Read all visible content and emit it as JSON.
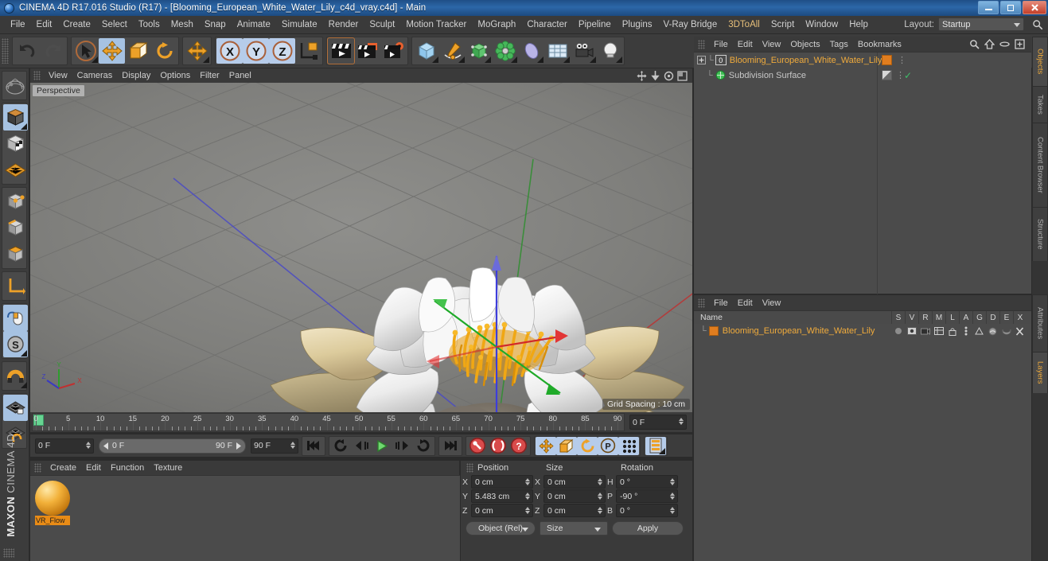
{
  "window": {
    "title": "CINEMA 4D R17.016 Studio (R17) - [Blooming_European_White_Water_Lily_c4d_vray.c4d] - Main",
    "app_icon": "c4d-logo-icon",
    "buttons": {
      "minimize": "minimize-icon",
      "restore": "restore-icon",
      "close": "close-icon"
    }
  },
  "menubar": {
    "items": [
      "File",
      "Edit",
      "Create",
      "Select",
      "Tools",
      "Mesh",
      "Snap",
      "Animate",
      "Simulate",
      "Render",
      "Sculpt",
      "Motion Tracker",
      "MoGraph",
      "Character",
      "Pipeline",
      "Plugins",
      "V-Ray Bridge",
      "3DToAll",
      "Script",
      "Window",
      "Help"
    ],
    "layout_label": "Layout:",
    "layout_value": "Startup",
    "search_icon": "search-icon"
  },
  "toolbar": {
    "groups": [
      {
        "name": "history",
        "buttons": [
          {
            "icon": "undo-icon",
            "state": "normal"
          },
          {
            "icon": "redo-icon",
            "state": "disabled"
          }
        ]
      },
      {
        "name": "transform",
        "buttons": [
          {
            "icon": "select-arrow-icon",
            "state": "normal"
          },
          {
            "icon": "move-icon",
            "state": "active"
          },
          {
            "icon": "scale-icon",
            "state": "normal"
          },
          {
            "icon": "rotate-icon",
            "state": "normal"
          }
        ]
      },
      {
        "name": "cursor",
        "buttons": [
          {
            "icon": "move-cursor-icon",
            "state": "normal"
          }
        ]
      },
      {
        "name": "axis-lock",
        "buttons": [
          {
            "icon": "x-axis-icon",
            "state": "active",
            "label": "X"
          },
          {
            "icon": "y-axis-icon",
            "state": "active",
            "label": "Y"
          },
          {
            "icon": "z-axis-icon",
            "state": "active",
            "label": "Z"
          },
          {
            "icon": "world-axis-icon",
            "state": "normal"
          }
        ]
      },
      {
        "name": "render",
        "buttons": [
          {
            "icon": "render-view-icon",
            "state": "normal"
          },
          {
            "icon": "render-to-picture-viewer-icon",
            "state": "normal"
          },
          {
            "icon": "render-settings-icon",
            "state": "normal"
          }
        ]
      },
      {
        "name": "create",
        "buttons": [
          {
            "icon": "cube-primitive-icon",
            "state": "normal"
          },
          {
            "icon": "spline-pen-icon",
            "state": "normal"
          },
          {
            "icon": "generator-nurbs-icon",
            "state": "normal"
          },
          {
            "icon": "deformer-icon",
            "state": "normal"
          },
          {
            "icon": "environment-icon",
            "state": "normal"
          },
          {
            "icon": "floor-scene-icon",
            "state": "normal"
          },
          {
            "icon": "camera-icon",
            "state": "normal"
          },
          {
            "icon": "light-icon",
            "state": "normal"
          }
        ]
      }
    ]
  },
  "lefttoolbar": {
    "groups": [
      {
        "buttons": [
          {
            "icon": "magnet-live-selection-icon",
            "state": "normal"
          }
        ]
      },
      {
        "buttons": [
          {
            "icon": "model-mode-icon",
            "state": "active"
          },
          {
            "icon": "texture-mode-icon",
            "state": "normal"
          },
          {
            "icon": "polygon-grid-icon",
            "state": "normal"
          }
        ]
      },
      {
        "buttons": [
          {
            "icon": "points-mode-icon",
            "state": "normal"
          },
          {
            "icon": "edges-mode-icon",
            "state": "normal"
          },
          {
            "icon": "polygons-mode-icon",
            "state": "normal"
          }
        ]
      },
      {
        "buttons": [
          {
            "icon": "axis-mode-icon",
            "state": "normal"
          }
        ]
      },
      {
        "buttons": [
          {
            "icon": "enable-axis-mouse-icon",
            "state": "active"
          },
          {
            "icon": "soft-selection-icon",
            "state": "active"
          }
        ]
      },
      {
        "buttons": [
          {
            "icon": "snap-magnet-icon",
            "state": "normal"
          }
        ]
      },
      {
        "buttons": [
          {
            "icon": "workplane-lock-icon",
            "state": "active"
          },
          {
            "icon": "workplane-rotate-icon",
            "state": "normal"
          }
        ]
      }
    ],
    "brand_line1": "MAXON",
    "brand_line2": "CINEMA 4D"
  },
  "viewport": {
    "menus": [
      "View",
      "Cameras",
      "Display",
      "Options",
      "Filter",
      "Panel"
    ],
    "corner_icons": [
      "pan-view-icon",
      "dolly-view-icon",
      "rotate-view-icon",
      "maximize-view-icon"
    ],
    "label": "Perspective",
    "grid_spacing": "Grid Spacing : 10 cm",
    "axis_indicator": {
      "x": "X",
      "y": "Y",
      "z": "Z"
    },
    "scene_object": "Blooming European White Water Lily",
    "gizmo": "move-gizmo-xyz"
  },
  "timeline": {
    "ruler_labels": [
      "0",
      "5",
      "10",
      "15",
      "20",
      "25",
      "30",
      "35",
      "40",
      "45",
      "50",
      "55",
      "60",
      "65",
      "70",
      "75",
      "80",
      "85",
      "90"
    ],
    "ruler_min": 0,
    "ruler_max": 90,
    "current_frame_marker": "0",
    "right_field": "0 F",
    "current_frame_field": "0 F",
    "range_start": "0 F",
    "range_end": "90 F",
    "end_frame_field": "90 F"
  },
  "transport": {
    "buttons": [
      {
        "icon": "go-to-start-icon"
      },
      {
        "icon": "play-backwards-loop-icon"
      },
      {
        "icon": "step-back-icon"
      },
      {
        "icon": "play-forward-icon"
      },
      {
        "icon": "step-forward-icon"
      },
      {
        "icon": "loop-playback-icon"
      },
      {
        "icon": "go-to-end-icon"
      },
      {
        "icon": "record-keyframe-icon"
      },
      {
        "icon": "autokeying-icon"
      },
      {
        "icon": "keyframe-selection-icon"
      },
      {
        "icon": "position-key-icon",
        "state": "active"
      },
      {
        "icon": "scale-key-icon",
        "state": "active"
      },
      {
        "icon": "rotation-key-icon",
        "state": "active"
      },
      {
        "icon": "pla-key-icon",
        "state": "active"
      },
      {
        "icon": "parameter-key-icon",
        "state": "active"
      },
      {
        "icon": "timeline-panel-icon",
        "state": "active"
      }
    ]
  },
  "material_manager": {
    "menus": [
      "Create",
      "Edit",
      "Function",
      "Texture"
    ],
    "materials": [
      {
        "name": "VR_Flow",
        "preview": "orange-sphere-preview",
        "selected": true
      }
    ]
  },
  "coordinates": {
    "columns": [
      "Position",
      "Size",
      "Rotation"
    ],
    "rows": [
      {
        "pos_label": "X",
        "pos_value": "0 cm",
        "size_label": "X",
        "size_value": "0 cm",
        "rot_label": "H",
        "rot_value": "0 °"
      },
      {
        "pos_label": "Y",
        "pos_value": "5.483 cm",
        "size_label": "Y",
        "size_value": "0 cm",
        "rot_label": "P",
        "rot_value": "-90 °"
      },
      {
        "pos_label": "Z",
        "pos_value": "0 cm",
        "size_label": "Z",
        "size_value": "0 cm",
        "rot_label": "B",
        "rot_value": "0 °"
      }
    ],
    "mode_select": "Object (Rel)",
    "size_select": "Size",
    "apply_button": "Apply"
  },
  "object_manager": {
    "menus": [
      "File",
      "Edit",
      "View",
      "Objects",
      "Tags",
      "Bookmarks"
    ],
    "header_icons": [
      "search-icon",
      "home-icon",
      "ellipse-icon",
      "expand-icon"
    ],
    "rows": [
      {
        "name": "Blooming_European_White_Water_Lily",
        "selected": true,
        "level": 0,
        "badge": "0",
        "tag_color": "#e07d1f",
        "expander": "+"
      },
      {
        "name": "Subdivision Surface",
        "selected": false,
        "level": 1,
        "icon": "subdivision-surface-icon",
        "check": true
      }
    ]
  },
  "attribute_manager": {
    "menus": [
      "File",
      "Edit",
      "View"
    ],
    "name_column": "Name",
    "columns": [
      "S",
      "V",
      "R",
      "M",
      "L",
      "A",
      "G",
      "D",
      "E",
      "X"
    ],
    "rows": [
      {
        "name": "Blooming_European_White_Water_Lily",
        "swatch": "#e07d1f",
        "selected": true
      }
    ]
  },
  "edge_tabs": {
    "top": [
      {
        "label": "Objects",
        "active": true
      },
      {
        "label": "Takes",
        "active": false
      },
      {
        "label": "Content Browser",
        "active": false
      },
      {
        "label": "Structure",
        "active": false
      }
    ],
    "bottom": [
      {
        "label": "Attributes",
        "active": false
      },
      {
        "label": "Layers",
        "active": true
      }
    ]
  },
  "colors": {
    "accent_orange": "#f0ab3c",
    "panel_bg": "#3a3a3a",
    "list_bg": "#4b4b4b",
    "active_blue": "#a6c2e2",
    "title_blue": "#2c67a8",
    "green_marker": "#67d492"
  }
}
